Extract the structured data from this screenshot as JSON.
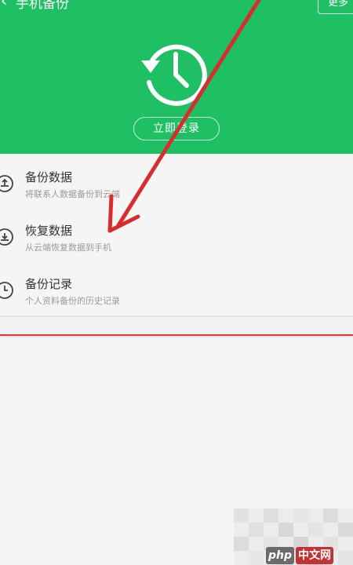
{
  "header": {
    "title": "手机备份",
    "more_label": "更多",
    "login_label": "立即登录",
    "back_icon": "chevron-left-icon",
    "hero_icon": "history-clock-icon",
    "background_color": "#1fbf63"
  },
  "menu": [
    {
      "label": "备份数据",
      "desc": "将联系人数据备份到云端",
      "icon": "cloud-upload-icon"
    },
    {
      "label": "恢复数据",
      "desc": "从云端恢复数据到手机",
      "icon": "cloud-download-icon"
    },
    {
      "label": "备份记录",
      "desc": "个人资料备份的历史记录",
      "icon": "clock-icon"
    }
  ],
  "annotation": {
    "arrow_color": "#d62e2e",
    "underline_color": "#d93a3a"
  },
  "watermark": {
    "php": "php",
    "site": "中文网"
  }
}
